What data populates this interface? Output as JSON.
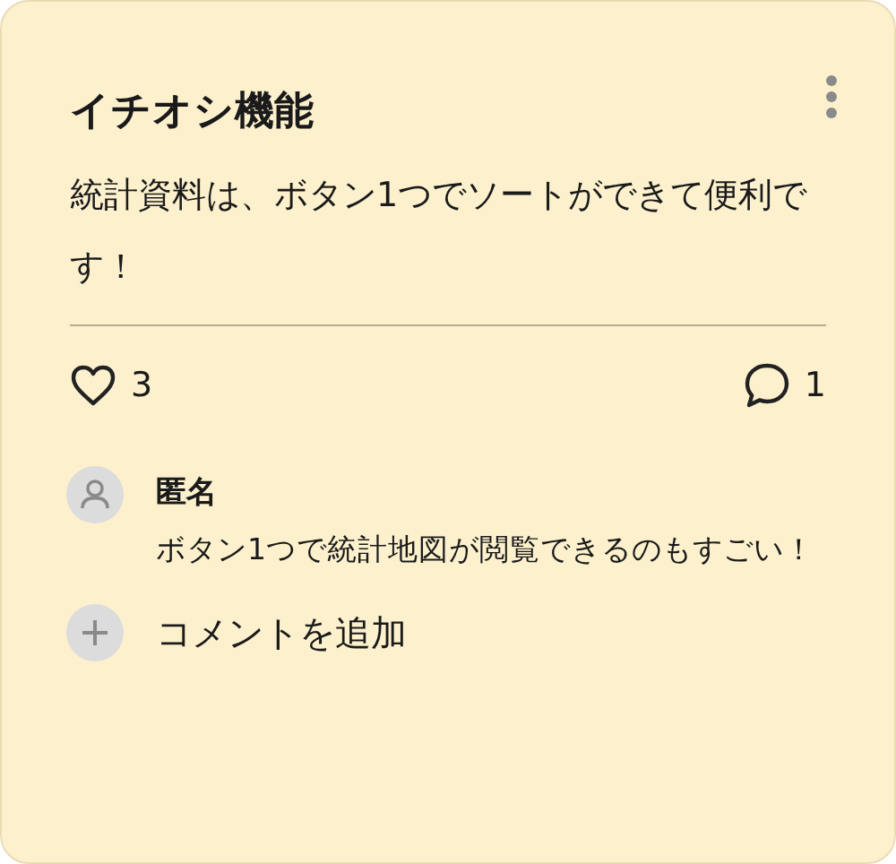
{
  "card": {
    "title": "イチオシ機能",
    "body": "統計資料は、ボタン1つでソートができて便利です！",
    "likes": "3",
    "comment_count": "1",
    "comments": [
      {
        "author": "匿名",
        "text": "ボタン1つで統計地図が閲覧できるのもすごい！"
      }
    ],
    "add_comment": "コメントを追加"
  }
}
